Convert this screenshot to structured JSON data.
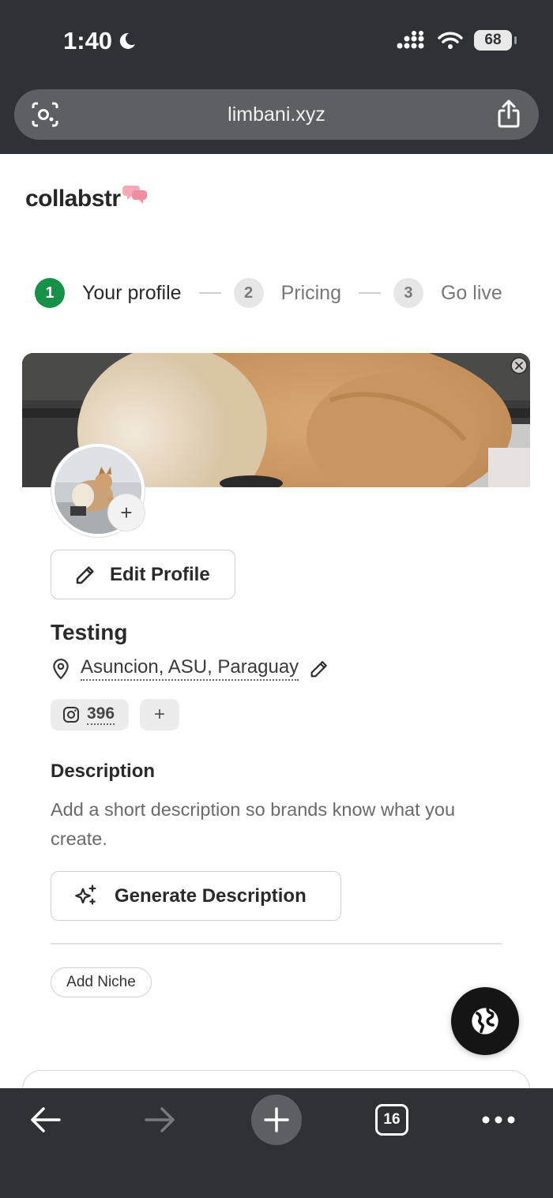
{
  "status_bar": {
    "time": "1:40",
    "battery": "68"
  },
  "browser": {
    "url": "limbani.xyz",
    "tab_count": "16"
  },
  "brand": {
    "logo_text": "collabstr"
  },
  "stepper": [
    {
      "number": "1",
      "label": "Your profile",
      "state": "active"
    },
    {
      "number": "2",
      "label": "Pricing",
      "state": "pending"
    },
    {
      "number": "3",
      "label": "Go live",
      "state": "pending"
    }
  ],
  "profile": {
    "edit_button": "Edit Profile",
    "name": "Testing",
    "location": "Asuncion, ASU, Paraguay",
    "instagram_followers": "396",
    "avatar_add_symbol": "+",
    "add_social_symbol": "+"
  },
  "description": {
    "heading": "Description",
    "text": "Add a short description so brands know what you create.",
    "generate_button": "Generate Description"
  },
  "niche": {
    "add_label": "Add Niche"
  },
  "colors": {
    "accent_green": "#179147",
    "chrome": "#2f3234",
    "fab": "#151515"
  }
}
